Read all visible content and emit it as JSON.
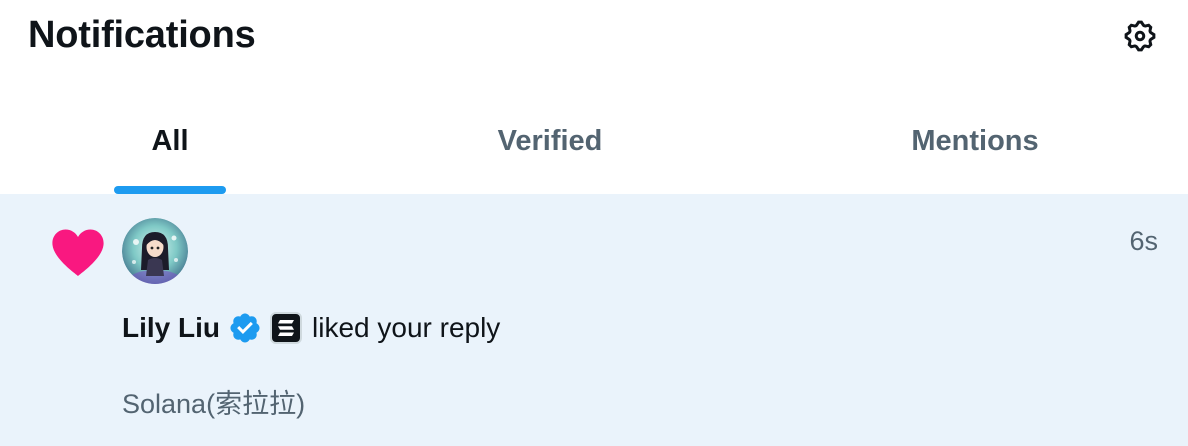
{
  "header": {
    "title": "Notifications",
    "settings_icon": "gear-icon"
  },
  "tabs": [
    {
      "label": "All",
      "active": true
    },
    {
      "label": "Verified",
      "active": false
    },
    {
      "label": "Mentions",
      "active": false
    }
  ],
  "colors": {
    "accent": "#1d9bf0",
    "like": "#f91880",
    "highlight_bg": "#eaf3fb",
    "secondary_text": "#536471"
  },
  "notification": {
    "type_icon": "heart-icon",
    "avatar_icon": "avatar",
    "user_name": "Lily Liu",
    "verified_icon": "verified-badge-icon",
    "affiliate_icon": "solana-badge-icon",
    "action": "liked your reply",
    "timestamp": "6s",
    "reply_text": "Solana(索拉拉)"
  }
}
